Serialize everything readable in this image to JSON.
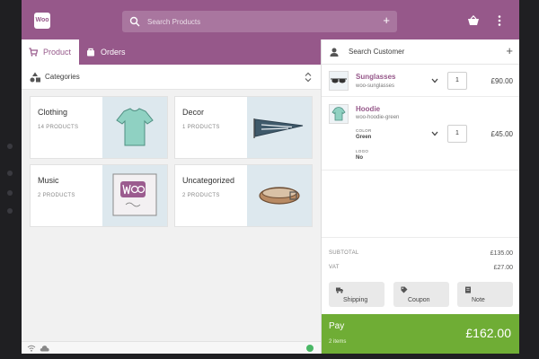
{
  "header": {
    "logo_text": "Woo",
    "search_placeholder": "Search Products",
    "add_symbol": "+"
  },
  "tabs": [
    {
      "label": "Product",
      "active": true
    },
    {
      "label": "Orders",
      "active": false
    }
  ],
  "categories_label": "Categories",
  "categories": [
    {
      "name": "Clothing",
      "count": "14 PRODUCTS",
      "icon": "tshirt-icon"
    },
    {
      "name": "Decor",
      "count": "1 PRODUCTS",
      "icon": "pennant-icon"
    },
    {
      "name": "Music",
      "count": "2 PRODUCTS",
      "icon": "album-icon"
    },
    {
      "name": "Uncategorized",
      "count": "2 PRODUCTS",
      "icon": "belt-icon"
    }
  ],
  "cart": {
    "customer_placeholder": "Search Customer",
    "add_symbol": "+",
    "items": [
      {
        "name": "Sunglasses",
        "sku": "woo-sunglasses",
        "qty": "1",
        "price": "£90.00",
        "icon": "sunglasses-icon"
      },
      {
        "name": "Hoodie",
        "sku": "woo-hoodie-green",
        "qty": "1",
        "price": "£45.00",
        "icon": "hoodie-icon",
        "attributes": [
          {
            "key": "COLOR",
            "value": "Green"
          },
          {
            "key": "LOGO",
            "value": "No"
          }
        ]
      }
    ],
    "totals": [
      {
        "label": "SUBTOTAL",
        "value": "£135.00"
      },
      {
        "label": "VAT",
        "value": "£27.00"
      }
    ],
    "actions": [
      {
        "label": "Shipping",
        "icon": "truck-icon"
      },
      {
        "label": "Coupon",
        "icon": "tag-icon"
      },
      {
        "label": "Note",
        "icon": "note-icon"
      }
    ],
    "pay": {
      "label": "Pay",
      "items": "2 items",
      "amount": "£162.00"
    }
  },
  "colors": {
    "brand": "#96588a",
    "pay": "#6fad35",
    "online": "#4ab866"
  }
}
